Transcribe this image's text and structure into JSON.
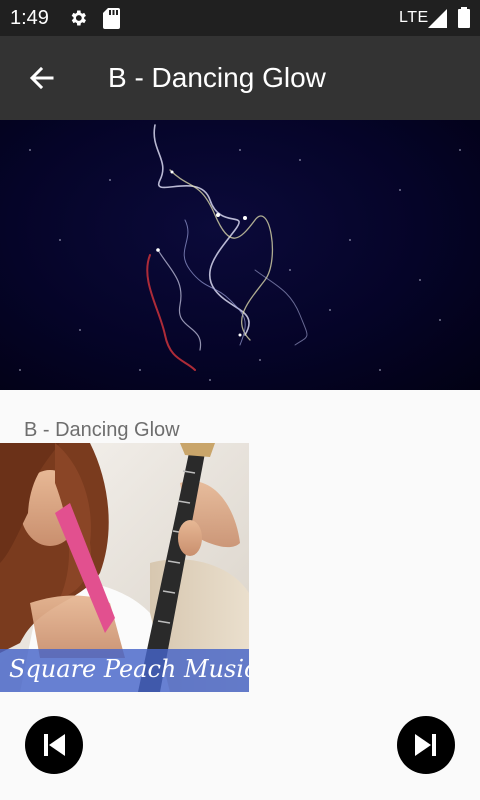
{
  "status_bar": {
    "time": "1:49",
    "network": "LTE",
    "icons": [
      "gear-icon",
      "sd-card-icon",
      "signal-icon",
      "battery-icon"
    ]
  },
  "app_bar": {
    "title": "B - Dancing Glow",
    "back_icon": "arrow-left-icon"
  },
  "now_playing": {
    "track_title": "B - Dancing Glow",
    "album_brand": "Square Peach Music"
  },
  "controls": {
    "previous_icon": "skip-previous-icon",
    "next_icon": "skip-next-icon"
  },
  "colors": {
    "status_bar_bg": "#202020",
    "app_bar_bg": "#333333",
    "page_bg": "#fafafa",
    "video_bg": "#050428",
    "control_bg": "#000000",
    "album_banner": "#4664c8"
  }
}
